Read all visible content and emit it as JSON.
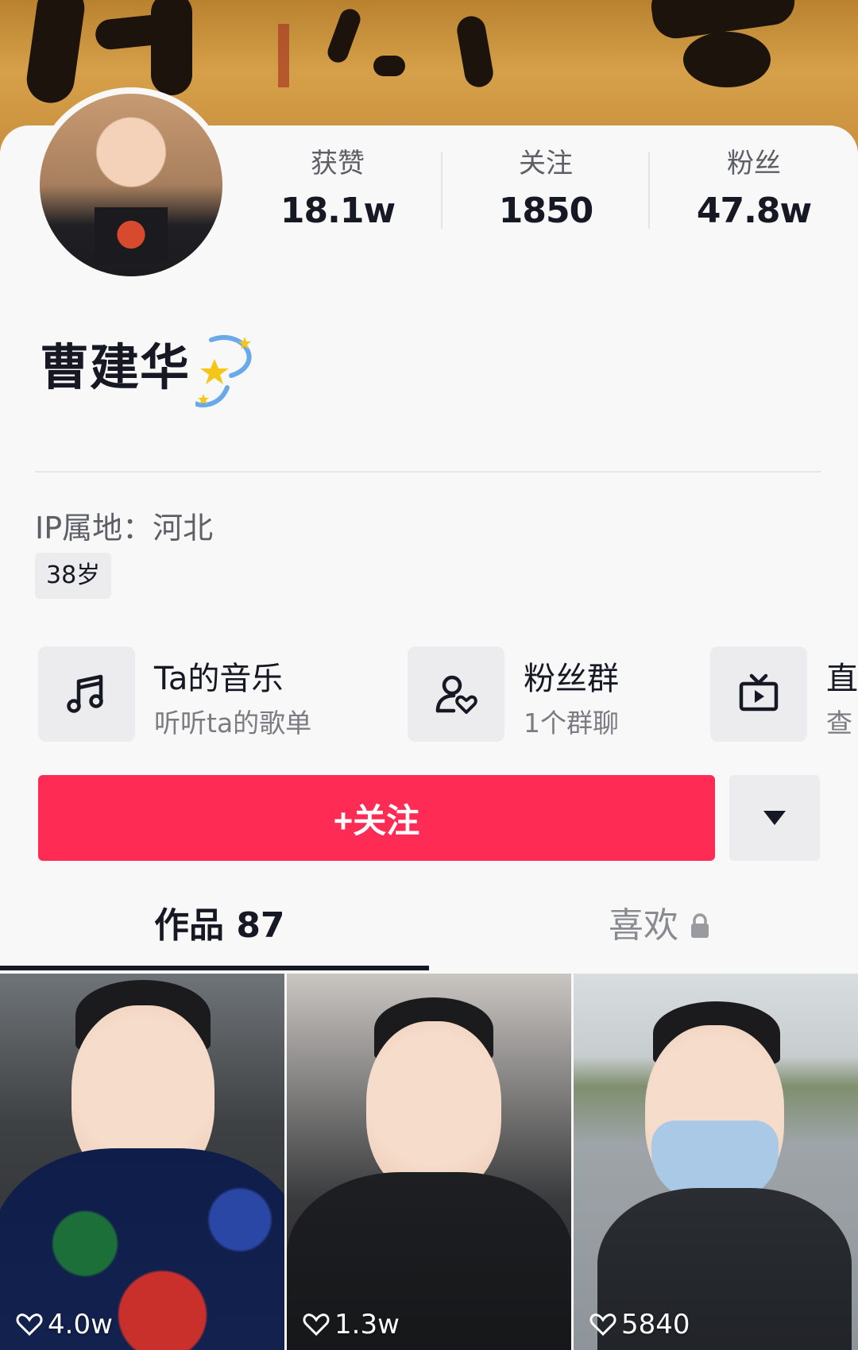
{
  "profile": {
    "name": "曹建华",
    "ip_location": "IP属地：河北",
    "age_tag": "38岁"
  },
  "stats": [
    {
      "label": "获赞",
      "value": "18.1w"
    },
    {
      "label": "关注",
      "value": "1850"
    },
    {
      "label": "粉丝",
      "value": "47.8w"
    }
  ],
  "features": [
    {
      "icon": "music-note-icon",
      "title": "Ta的音乐",
      "subtitle": "听听ta的歌单"
    },
    {
      "icon": "fan-group-icon",
      "title": "粉丝群",
      "subtitle": "1个群聊"
    },
    {
      "icon": "tv-icon",
      "title": "直",
      "subtitle": "查"
    }
  ],
  "actions": {
    "follow_label": "+关注",
    "more_icon": "caret-down-icon"
  },
  "tabs": {
    "works": "作品 87",
    "likes": "喜欢",
    "likes_icon": "lock-icon"
  },
  "videos": [
    {
      "likes": "4.0w"
    },
    {
      "likes": "1.3w"
    },
    {
      "likes": "5840"
    }
  ],
  "colors": {
    "accent": "#fe2c55",
    "text": "#161823",
    "muted": "#5e5f66",
    "background": "#f8f8f8"
  }
}
